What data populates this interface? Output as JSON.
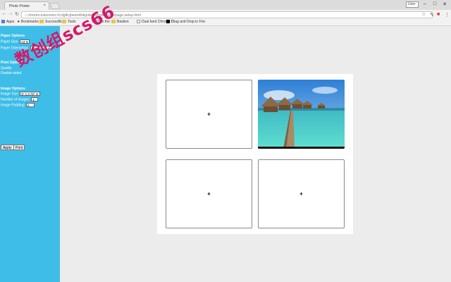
{
  "browser": {
    "tab_title": "Photo Printer",
    "url": "chrome-extension://cnlgfkcjbeemkhkgnkmoengibdipaeb/page-setup.html",
    "user_badge": "User",
    "win_min": "–",
    "win_max": "□",
    "win_close": "✕",
    "tab_close": "×",
    "bookmarks": {
      "apps": "Apps",
      "bookmarks": "Bookmarks",
      "succeed": "SuccessBuild",
      "tools": "Tools",
      "on_the": "SEO on the",
      "bastion": "Bastion",
      "dual_boot": "Dual boot Chrome O",
      "drag_drop": "Drag and Drop in Fire"
    }
  },
  "sidebar": {
    "paper_title": "Paper Options",
    "paper_size_label": "Paper Size",
    "paper_size_value": "A4",
    "paper_orientation_label": "Paper Orientation",
    "paper_orientation_value": "Landscape",
    "print_title": "Print Options",
    "quality_label": "Quality",
    "double_label": "Double-sided",
    "image_title": "Image Options",
    "image_size_label": "Image Size",
    "image_size_value": "5\" x 3.75\"",
    "number_label": "Number of images",
    "number_value": "1",
    "padding_label": "Image Padding",
    "padding_value": "0",
    "apply_label": "Apply",
    "print_label": "Print"
  },
  "watermark": "数创组scs66",
  "slots": {
    "plus": "+"
  },
  "colors": {
    "sidebar": "#3dbde8",
    "background": "#ececec",
    "watermark": "#d11a6a"
  }
}
